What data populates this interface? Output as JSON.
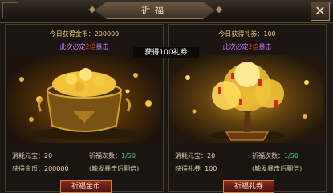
{
  "window": {
    "title": "祈福",
    "close_label": "✕"
  },
  "toast": "获得100礼券",
  "gold_panel": {
    "today_gain": "今日获得金币：200000",
    "crit_prefix": "此次必定",
    "crit_num": "2倍",
    "crit_suffix": "暴击",
    "cost_label": "消耗元宝：",
    "cost_value": "20",
    "count_label": "祈福次数：",
    "count_value": "1/50",
    "gain_label": "获得金币：",
    "gain_value": "200000",
    "note": "(触发暴击后翻倍)",
    "button": "祈福金币"
  },
  "coupon_panel": {
    "today_gain": "今日获得礼券：100",
    "crit_prefix": "此次必定",
    "crit_num": "2倍",
    "crit_suffix": "暴击",
    "cost_label": "消耗元宝：",
    "cost_value": "20",
    "count_label": "祈福次数：",
    "count_value": "1/50",
    "gain_label": "获得礼券",
    "gain_value": "100",
    "note": "(触发暴击后翻倍)",
    "button": "祈福礼券"
  },
  "colors": {
    "accent_gold": "#f0d27a",
    "crit_purple": "#c77aff",
    "crit_red": "#ff3a2a",
    "count_green": "#3fd86a"
  }
}
